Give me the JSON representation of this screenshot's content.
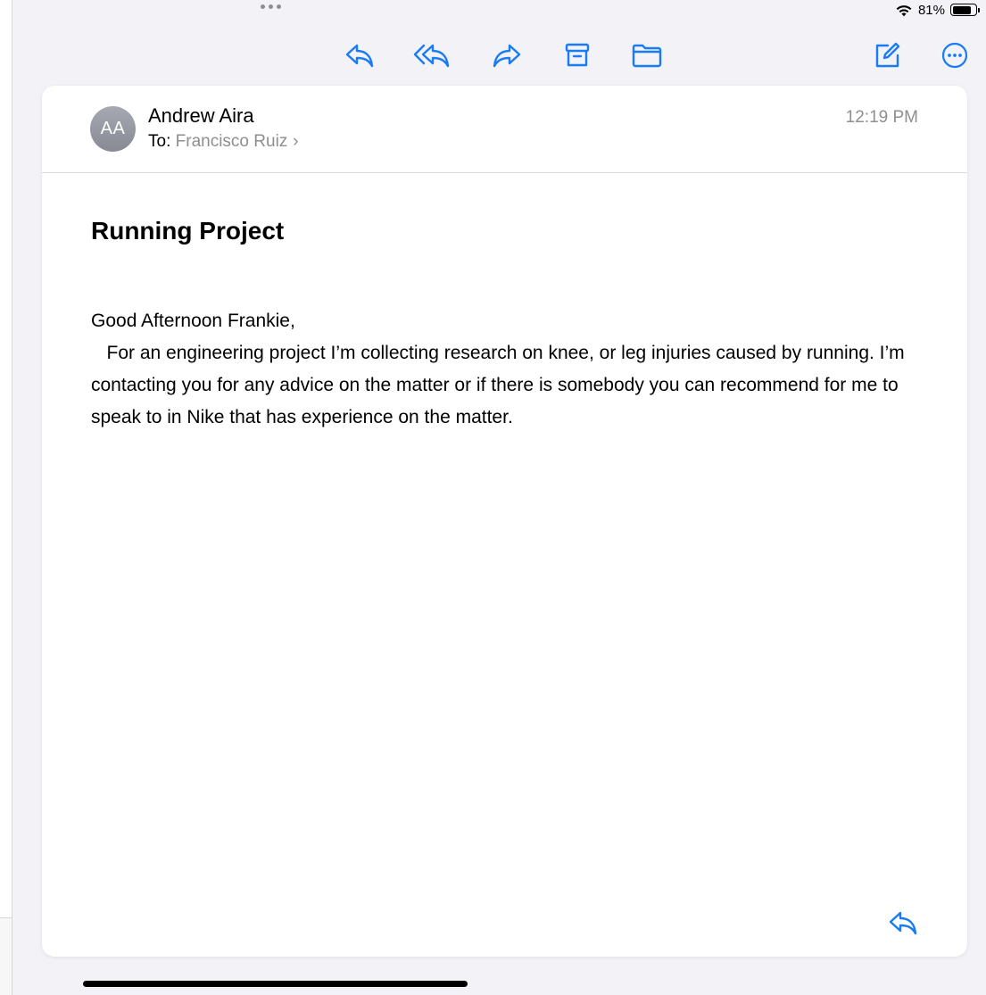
{
  "status_bar": {
    "battery_percent": "81%",
    "battery_level": 0.81,
    "icons": [
      "wifi-icon",
      "battery-icon"
    ]
  },
  "toolbar": {
    "icons": [
      "reply-icon",
      "reply-all-icon",
      "forward-icon",
      "archive-icon",
      "folder-icon",
      "compose-icon",
      "more-icon"
    ],
    "accent_color": "#1a7cf5"
  },
  "message": {
    "avatar_initials": "AA",
    "sender": "Andrew Aira",
    "to_label": "To:",
    "recipient": "Francisco Ruiz",
    "time": "12:19 PM",
    "subject": "Running Project",
    "greeting": "Good Afternoon Frankie,",
    "paragraph": "   For an engineering project I’m collecting research on knee, or leg injuries caused by running. I’m contacting you for any advice on the matter or if there is somebody you can recommend for me to speak to in Nike that has experience on the matter."
  }
}
